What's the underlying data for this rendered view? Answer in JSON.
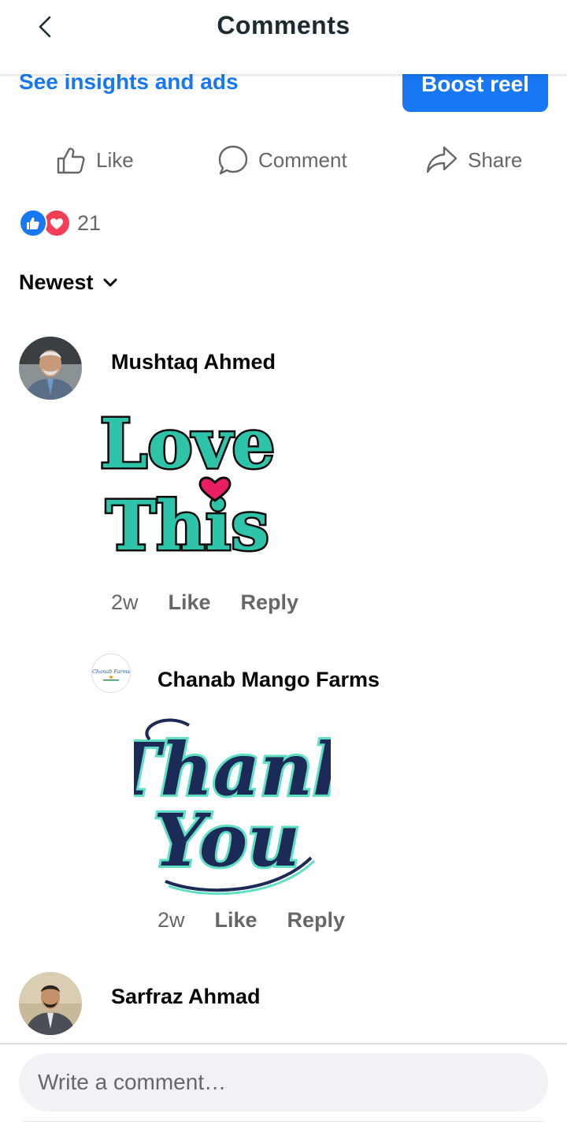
{
  "header": {
    "title": "Comments",
    "back_icon": "chevron-left-icon"
  },
  "insights": {
    "link_label": "See insights and ads",
    "boost_label": "Boost reel",
    "accent": "#1877f2"
  },
  "actions": [
    {
      "label": "Like",
      "icon": "thumbs-up-icon"
    },
    {
      "label": "Comment",
      "icon": "comment-bubble-icon"
    },
    {
      "label": "Share",
      "icon": "share-arrow-icon"
    }
  ],
  "reactions": {
    "count": "21",
    "types": [
      "like",
      "love"
    ]
  },
  "sort": {
    "label": "Newest",
    "icon": "chevron-down-icon"
  },
  "comments": [
    {
      "author": "Mushtaq Ahmed",
      "sticker_text": [
        "Love",
        "This"
      ],
      "time": "2w",
      "like_label": "Like",
      "reply_label": "Reply",
      "replies": [
        {
          "author": "Chanab Mango Farms",
          "avatar_text": "Chanab Farms",
          "sticker_text": [
            "Thank",
            "You"
          ],
          "time": "2w",
          "like_label": "Like",
          "reply_label": "Reply"
        }
      ]
    },
    {
      "author": "Sarfraz Ahmad"
    }
  ],
  "composer": {
    "placeholder": "Write a comment…"
  }
}
